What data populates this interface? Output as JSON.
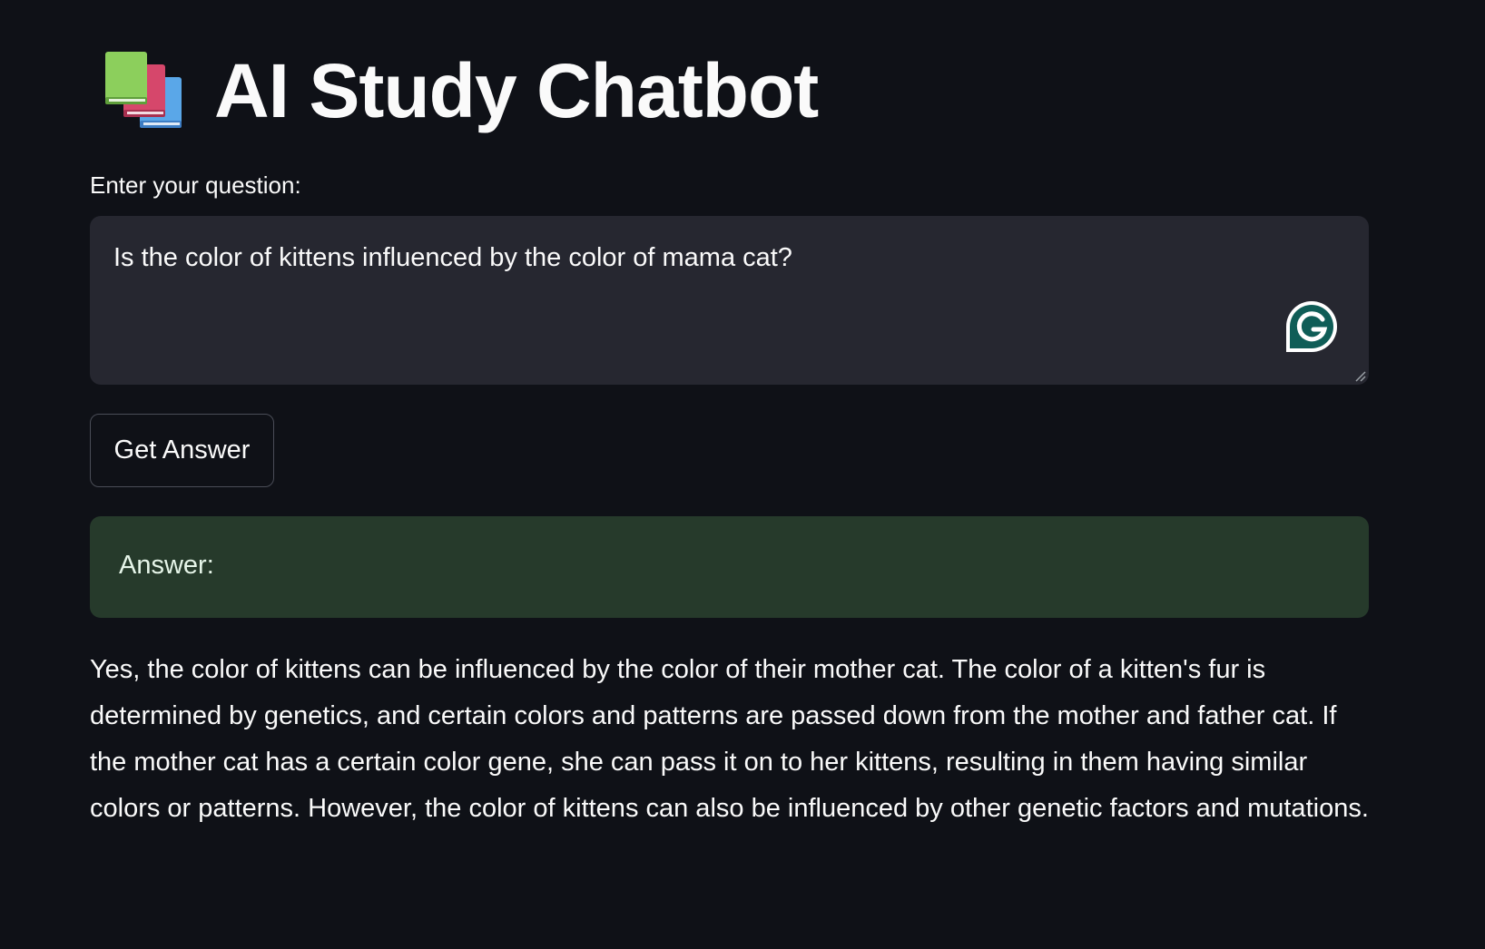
{
  "header": {
    "title": "AI Study Chatbot",
    "icon": "books-icon"
  },
  "question": {
    "label": "Enter your question:",
    "value": "Is the color of kittens influenced by the color of mama cat?",
    "assistant_icon": "grammarly-icon"
  },
  "actions": {
    "submit_label": "Get Answer"
  },
  "answer": {
    "label": "Answer:",
    "text": "Yes, the color of kittens can be influenced by the color of their mother cat. The color of a kitten's fur is determined by genetics, and certain colors and patterns are passed down from the mother and father cat. If the mother cat has a certain color gene, she can pass it on to her kittens, resulting in them having similar colors or patterns. However, the color of kittens can also be influenced by other genetic factors and mutations."
  },
  "colors": {
    "background": "#0f1117",
    "input_background": "#262730",
    "success_background": "#263a2b",
    "grammarly_green": "#15c39a"
  }
}
